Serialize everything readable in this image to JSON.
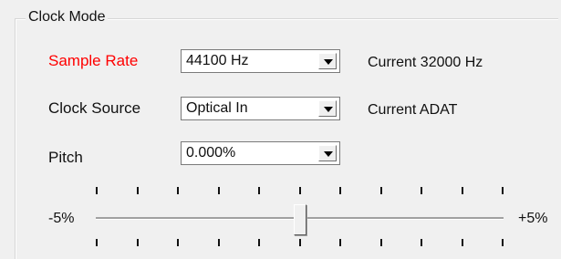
{
  "group": {
    "title": "Clock Mode"
  },
  "rows": [
    {
      "label": "Sample Rate",
      "value": "44100 Hz",
      "current": "Current  32000 Hz"
    },
    {
      "label": "Clock Source",
      "value": "Optical In",
      "current": "Current  ADAT"
    },
    {
      "label": "Pitch",
      "value": "0.000%",
      "current": ""
    }
  ],
  "slider": {
    "min_label": "-5%",
    "max_label": "+5%",
    "position_fraction": 0.5
  },
  "colors": {
    "highlight_label": "#ff0000"
  }
}
